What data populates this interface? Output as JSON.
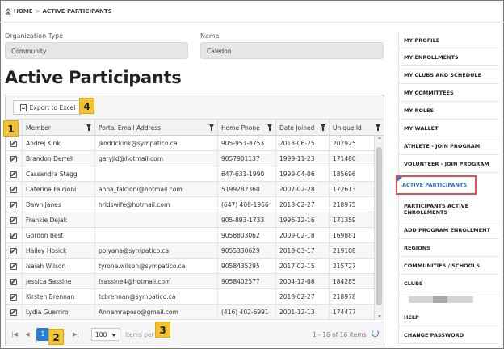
{
  "breadcrumb": {
    "home": "HOME",
    "separator": ">",
    "current": "ACTIVE PARTICIPANTS"
  },
  "filters": {
    "org_type_label": "Organization Type",
    "org_type_value": "Community",
    "name_label": "Name",
    "name_value": "Caledon"
  },
  "page_title": "Active Participants",
  "toolbar": {
    "export_label": "Export to Excel"
  },
  "columns": [
    "Member",
    "Portal Email Address",
    "Home Phone",
    "Date Joined",
    "Unique Id"
  ],
  "rows": [
    [
      "Andrej Kink",
      "jkodrickink@sympatico.ca",
      "905-951-8753",
      "2013-06-25",
      "202925"
    ],
    [
      "Brandon Derrell",
      "garyjld@hotmail.com",
      "9057901137",
      "1999-11-23",
      "171480"
    ],
    [
      "Cassandra Stagg",
      "",
      "647-631-1990",
      "1999-04-06",
      "185696"
    ],
    [
      "Caterina Falcioni",
      "anna_falcioni@hotmail.com",
      "5199282360",
      "2007-02-28",
      "172613"
    ],
    [
      "Dawn Janes",
      "hrldswife@hotmail.com",
      "(647) 408-1966",
      "2018-02-27",
      "218975"
    ],
    [
      "Frankie Dejak",
      "",
      "905-893-1733",
      "1996-12-16",
      "171359"
    ],
    [
      "Gordon Best",
      "",
      "9058803062",
      "2009-02-18",
      "169881"
    ],
    [
      "Hailey Hosick",
      "polyana@sympatico.ca",
      "9055330629",
      "2018-03-17",
      "219108"
    ],
    [
      "Isaiah Wilson",
      "tyrone.wilson@sympatico.ca",
      "9058435295",
      "2017-02-15",
      "215727"
    ],
    [
      "Jessica Sassine",
      "fsassine4@hotmail.com",
      "9058402577",
      "2004-12-08",
      "184285"
    ],
    [
      "Kirsten Brennan",
      "tcbrennan@sympatico.ca",
      "",
      "2018-02-27",
      "218978"
    ],
    [
      "Lydia Guerriro",
      "Annemraposo@gmail.com",
      "(416) 402-6991",
      "2001-12-13",
      "174477"
    ]
  ],
  "pager": {
    "first": "|◀",
    "prev": "◀",
    "current_page": "1",
    "next": "▶",
    "last": "▶|",
    "page_size": "100",
    "page_size_text": "items per p",
    "info": "1 - 16 of 16 items"
  },
  "callouts": [
    "1",
    "2",
    "3",
    "4"
  ],
  "sidebar": {
    "items": [
      "MY PROFILE",
      "MY ENROLLMENTS",
      "MY CLUBS AND SCHEDULE",
      "MY COMMITTEES",
      "MY ROLES",
      "MY WALLET",
      "ATHLETE - JOIN PROGRAM",
      "VOLUNTEER - JOIN PROGRAM",
      "ACTIVE PARTICIPANTS",
      "PARTICIPANTS ACTIVE ENROLLMENTS",
      "ADD PROGRAM ENROLLMENT",
      "REGIONS",
      "COMMUNITIES / SCHOOLS",
      "CLUBS",
      "HELP",
      "CHANGE PASSWORD"
    ]
  },
  "colors": {
    "accent": "#2a7fd4",
    "callout": "#f4c430",
    "highlight_border": "#e05050"
  }
}
